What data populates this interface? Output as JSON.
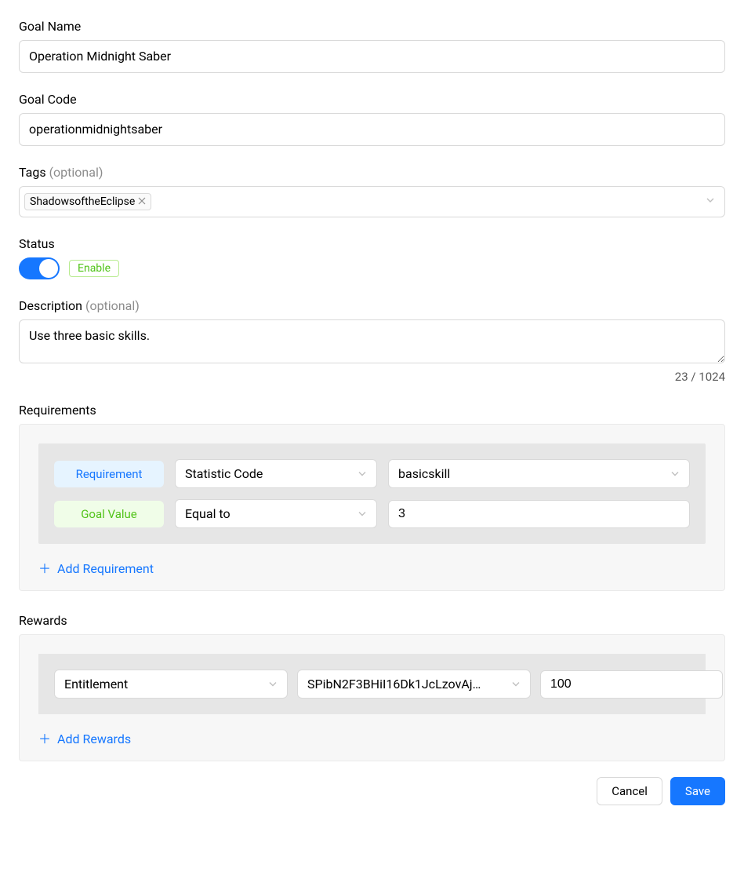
{
  "fields": {
    "goal_name": {
      "label": "Goal Name",
      "value": "Operation Midnight Saber"
    },
    "goal_code": {
      "label": "Goal Code",
      "value": "operationmidnightsaber"
    },
    "tags": {
      "label": "Tags",
      "optional": "(optional)",
      "chips": [
        "ShadowsoftheEclipse"
      ]
    },
    "status": {
      "label": "Status",
      "badge": "Enable",
      "enabled": true
    },
    "description": {
      "label": "Description",
      "optional": "(optional)",
      "value": "Use three basic skills.",
      "counter": "23 / 1024"
    }
  },
  "requirements": {
    "label": "Requirements",
    "row1": {
      "badge": "Requirement",
      "type": "Statistic Code",
      "value": "basicskill"
    },
    "row2": {
      "badge": "Goal Value",
      "op": "Equal to",
      "value": "3"
    },
    "add": "Add Requirement"
  },
  "rewards": {
    "label": "Rewards",
    "type": "Entitlement",
    "item": "SPibN2F3BHiI16Dk1JcLzovAj…",
    "qty": "100",
    "add": "Add Rewards"
  },
  "footer": {
    "cancel": "Cancel",
    "save": "Save"
  }
}
